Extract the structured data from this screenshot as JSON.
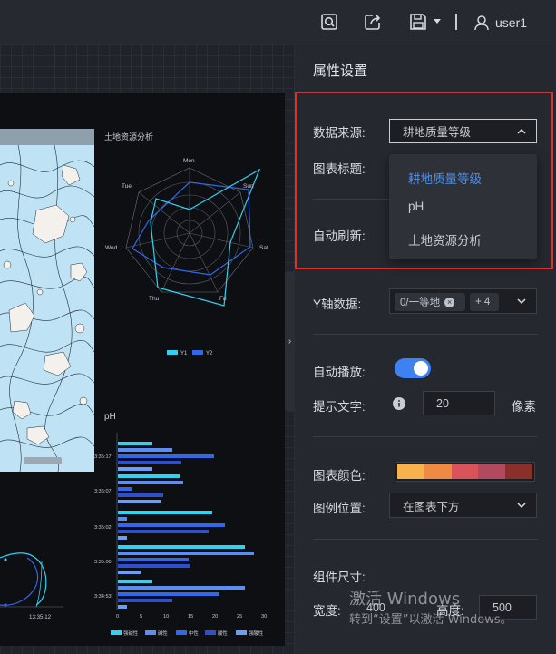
{
  "topbar": {
    "icons": [
      "preview-icon",
      "share-icon",
      "save-icon",
      "chevron-down-icon",
      "user-icon"
    ],
    "username": "user1"
  },
  "dashboard": {
    "radar_title": "土地资源分析",
    "radar_axes": [
      "Mon",
      "Sun",
      "Sat",
      "Fri",
      "Thu",
      "Wed",
      "Tue"
    ],
    "radar_legend": [
      "Y1",
      "Y2"
    ],
    "bar_title": "pH",
    "bar_categories": [
      "3:35:17",
      "3:35:07",
      "3:35:02",
      "3:35:00",
      "3:34:53"
    ],
    "bar_x_ticks": [
      "0",
      "5",
      "10",
      "15",
      "20",
      "25",
      "30"
    ],
    "bar_legend": [
      "强碱性",
      "碱性",
      "中性",
      "酸性",
      "强酸性"
    ],
    "bottom_chart_label": "13:35:12"
  },
  "props": {
    "title": "属性设置",
    "data_source_label": "数据来源:",
    "data_source_value": "耕地质量等级",
    "chart_title_label": "图表标题:",
    "dropdown_options": [
      "耕地质量等级",
      "pH",
      "土地资源分析"
    ],
    "auto_refresh_label": "自动刷新:",
    "y_axis_label": "Y轴数据:",
    "y_axis_tag": "0/一等地",
    "y_axis_more": "+ 4",
    "autoplay_label": "自动播放:",
    "autoplay_on": true,
    "tooltip_label": "提示文字:",
    "tooltip_value": "20",
    "tooltip_unit": "像素",
    "chart_color_label": "图表颜色:",
    "palette": [
      "#f7b14d",
      "#ee8a43",
      "#d9535a",
      "#b14a5f",
      "#8a2f2a"
    ],
    "legend_pos_label": "图例位置:",
    "legend_pos_value": "在图表下方",
    "size_label": "组件尺寸:",
    "width_label": "宽度:",
    "width_value": "400",
    "height_label": "高度:",
    "height_value": "500"
  },
  "watermark": {
    "line1": "激活 Windows",
    "line2": "转到“设置”以激活 Windows。"
  },
  "colors": {
    "accent": "#3d82f0",
    "highlight": "#e0302b",
    "cyan": "#33d1f0",
    "blue": "#3466e8"
  }
}
